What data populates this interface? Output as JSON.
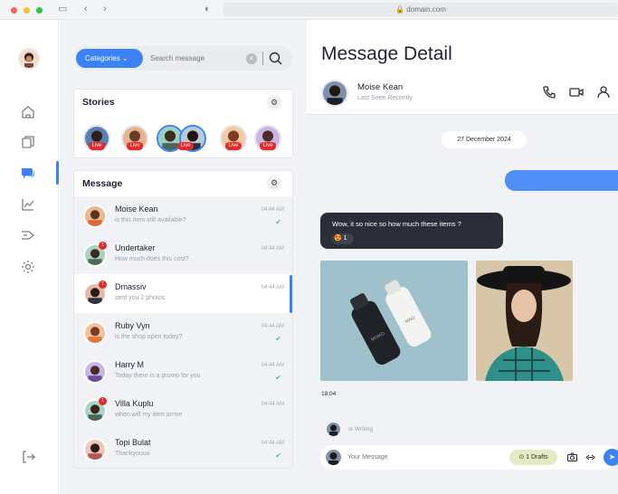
{
  "browser": {
    "url": "domain.com"
  },
  "search": {
    "category_label": "Categories",
    "placeholder": "Search message"
  },
  "stories": {
    "title": "Stories",
    "live_label": "Live"
  },
  "messages": {
    "title": "Message",
    "items": [
      {
        "name": "Moise Kean",
        "preview": "is this item still available?",
        "time": "04:44 AM",
        "read": true
      },
      {
        "name": "Undertaker",
        "preview": "How much does this cost?",
        "time": "04:44 AM",
        "badge": "1"
      },
      {
        "name": "Dmassiv",
        "preview": "sent you 2 photos",
        "time": "04:44 AM",
        "badge": "1",
        "active": true
      },
      {
        "name": "Ruby Vyn",
        "preview": "is the shop open today?",
        "time": "04:44 AM",
        "read": true
      },
      {
        "name": "Harry M",
        "preview": "Today there is a promo for you",
        "time": "04:44 AM",
        "read": true
      },
      {
        "name": "Villa Kuplu",
        "preview": "when will my item arrive",
        "time": "04:44 AM",
        "badge": "1"
      },
      {
        "name": "Topi Bulat",
        "preview": "Thankyouuu",
        "time": "04:44 AM",
        "read": true
      }
    ]
  },
  "detail": {
    "title": "Message Detail",
    "contact_name": "Moise Kean",
    "contact_status": "Last Seen Recently",
    "date_chip": "27 December 2024",
    "incoming_text": "Wow, it so nice so how much these items ?",
    "reaction_emoji": "😍",
    "reaction_count": "1",
    "bottle_label_dark": "MOMO",
    "bottle_label_light": "MAO",
    "photo_time": "18:04",
    "typing": "Is Writing",
    "input_placeholder": "Your Message",
    "drafts": "1 Drafts"
  },
  "colors": {
    "accent": "#3b82f6",
    "live": "#e52929",
    "check": "#53c078"
  }
}
